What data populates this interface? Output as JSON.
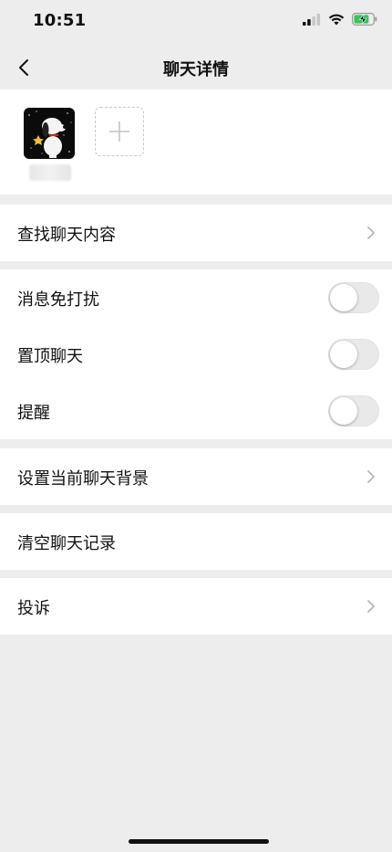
{
  "status_bar": {
    "time": "10:51",
    "icons": [
      "signal-icon",
      "wifi-icon",
      "battery-charging-icon"
    ]
  },
  "nav": {
    "title": "聊天详情",
    "back_icon": "chevron-left-icon"
  },
  "members": {
    "add_icon": "plus-icon"
  },
  "rows": {
    "search_history": "查找聊天内容",
    "mute": "消息免打扰",
    "pin": "置顶聊天",
    "remind": "提醒",
    "background": "设置当前聊天背景",
    "clear": "清空聊天记录",
    "report": "投诉"
  },
  "toggles": {
    "mute": false,
    "pin": false,
    "remind": false
  },
  "colors": {
    "page_bg": "#ededed",
    "card_bg": "#ffffff",
    "toggle_off": "#e9e9e9",
    "chevron": "#b2b2b2"
  }
}
